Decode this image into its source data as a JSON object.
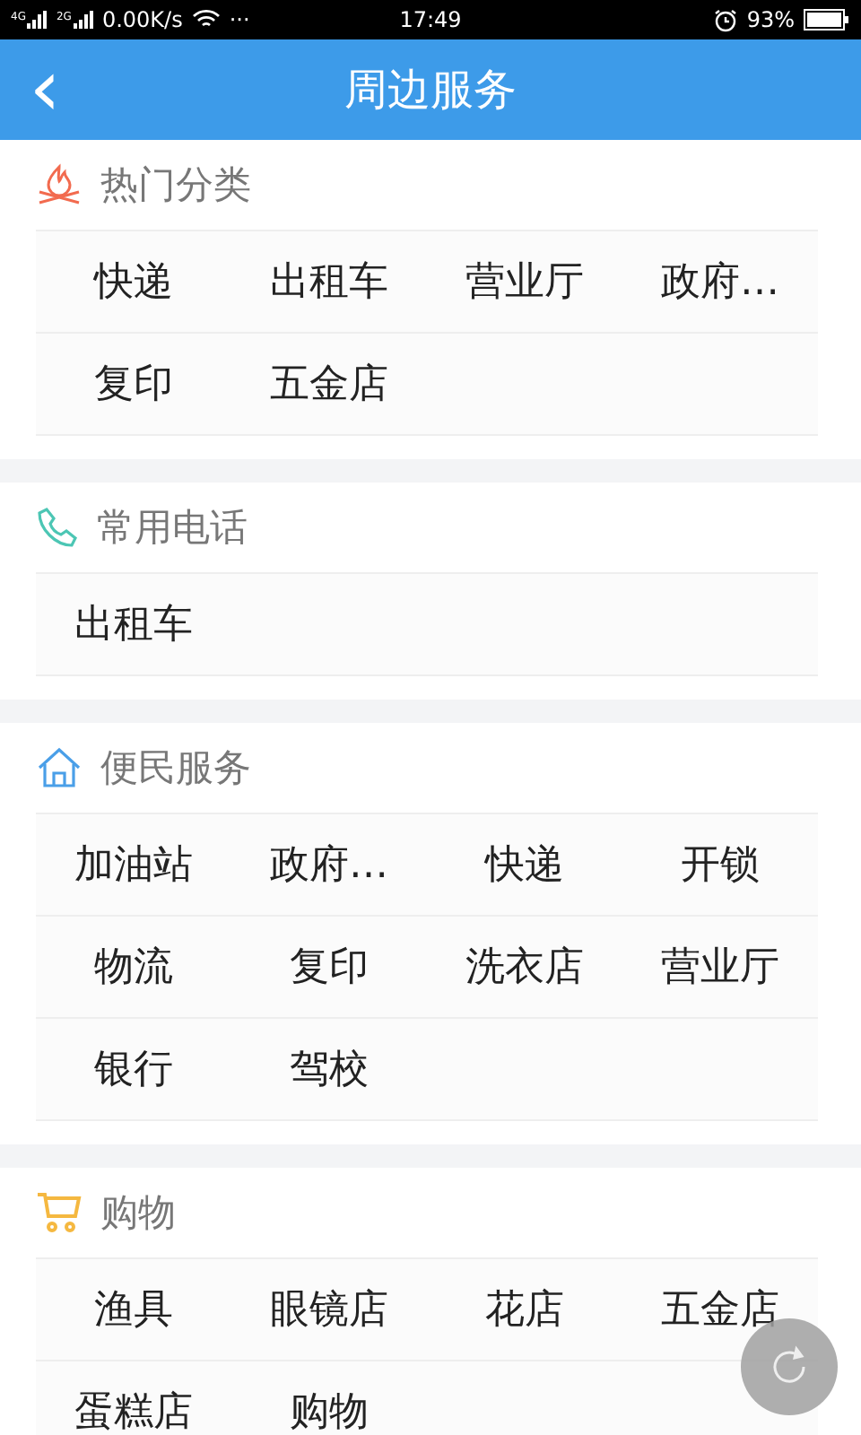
{
  "status_bar": {
    "sim_labels": [
      "4G",
      "2G"
    ],
    "speed": "0.00K/s",
    "more": "···",
    "time": "17:49",
    "battery": "93%"
  },
  "header": {
    "back": "‹",
    "title": "周边服务"
  },
  "sections": [
    {
      "title": "热门分类",
      "items": [
        "快递",
        "出租车",
        "营业厅",
        "政府…",
        "复印",
        "五金店"
      ]
    },
    {
      "title": "常用电话",
      "items": [
        "出租车"
      ]
    },
    {
      "title": "便民服务",
      "items": [
        "加油站",
        "政府…",
        "快递",
        "开锁",
        "物流",
        "复印",
        "洗衣店",
        "营业厅",
        "银行",
        "驾校"
      ]
    },
    {
      "title": "购物",
      "items": [
        "渔具",
        "眼镜店",
        "花店",
        "五金店",
        "蛋糕店",
        "购物"
      ]
    }
  ]
}
